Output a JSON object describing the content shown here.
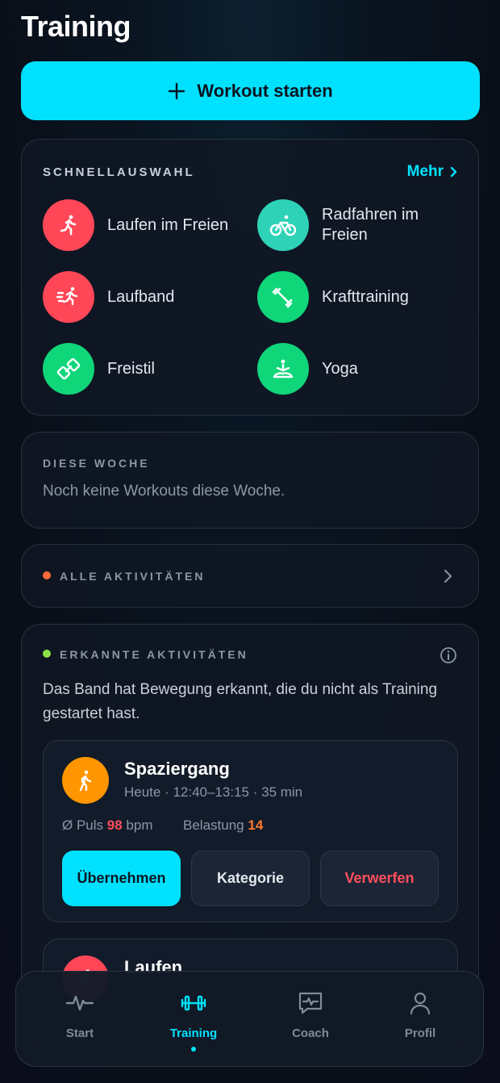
{
  "header": {
    "title": "Training"
  },
  "start_button": {
    "label": "Workout starten",
    "icon": "plus-icon"
  },
  "quick": {
    "title": "SCHNELLAUSWAHL",
    "more_label": "Mehr",
    "items": [
      {
        "label": "Laufen im Freien",
        "icon": "running-icon",
        "color": "#ff4757"
      },
      {
        "label": "Radfahren im Freien",
        "icon": "cycling-icon",
        "color": "#2ed3b7"
      },
      {
        "label": "Laufband",
        "icon": "treadmill-icon",
        "color": "#ff4757"
      },
      {
        "label": "Krafttraining",
        "icon": "dumbbell-icon",
        "color": "#10d67a"
      },
      {
        "label": "Freistil",
        "icon": "freestyle-icon",
        "color": "#10d67a"
      },
      {
        "label": "Yoga",
        "icon": "yoga-icon",
        "color": "#10d67a"
      }
    ]
  },
  "week": {
    "title": "DIESE WOCHE",
    "empty_text": "Noch keine Workouts diese Woche."
  },
  "all_activities": {
    "title": "ALLE AKTIVITÄTEN"
  },
  "detected": {
    "title": "ERKANNTE AKTIVITÄTEN",
    "description": "Das Band hat Bewegung erkannt, die du nicht als Training gestartet hast.",
    "activities": [
      {
        "title": "Spaziergang",
        "subtitle": "Heute · 12:40–13:15 · 35 min",
        "icon": "walking-icon",
        "color": "#ff9500",
        "pulse_label": "Ø Puls",
        "pulse_value": "98",
        "pulse_unit": "bpm",
        "load_label": "Belastung",
        "load_value": "14",
        "accept_label": "Übernehmen",
        "category_label": "Kategorie",
        "discard_label": "Verwerfen"
      },
      {
        "title": "Laufen",
        "icon": "running-icon",
        "color": "#ff4757"
      }
    ]
  },
  "tabs": [
    {
      "label": "Start",
      "icon": "pulse-icon",
      "active": false
    },
    {
      "label": "Training",
      "icon": "dumbbell-icon",
      "active": true
    },
    {
      "label": "Coach",
      "icon": "chat-pulse-icon",
      "active": false
    },
    {
      "label": "Profil",
      "icon": "person-icon",
      "active": false
    }
  ],
  "colors": {
    "accent": "#00e1ff",
    "pulse_value": "#ff4f5e",
    "load_value": "#ff7a2f",
    "discard": "#ff4f5e"
  }
}
